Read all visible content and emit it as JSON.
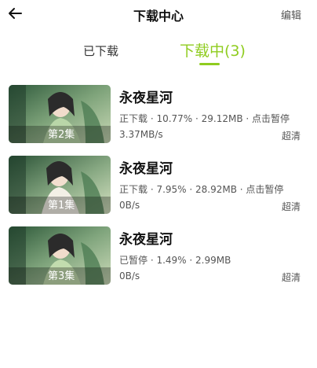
{
  "header": {
    "title": "下载中心",
    "edit_label": "编辑"
  },
  "tabs": [
    {
      "label": "已下载"
    },
    {
      "label": "下载中(3)",
      "active": true
    }
  ],
  "colors": {
    "accent": "#8fcc1f"
  },
  "items": [
    {
      "title": "永夜星河",
      "episode": "第2集",
      "status": "正下载 · 10.77% · 29.12MB · 点击暂停",
      "speed": "3.37MB/s",
      "quality": "超清"
    },
    {
      "title": "永夜星河",
      "episode": "第1集",
      "status": "正下载 · 7.95% · 28.92MB · 点击暂停",
      "speed": "0B/s",
      "quality": "超清"
    },
    {
      "title": "永夜星河",
      "episode": "第3集",
      "status": "已暂停 · 1.49% · 2.99MB",
      "speed": "0B/s",
      "quality": "超清"
    }
  ]
}
